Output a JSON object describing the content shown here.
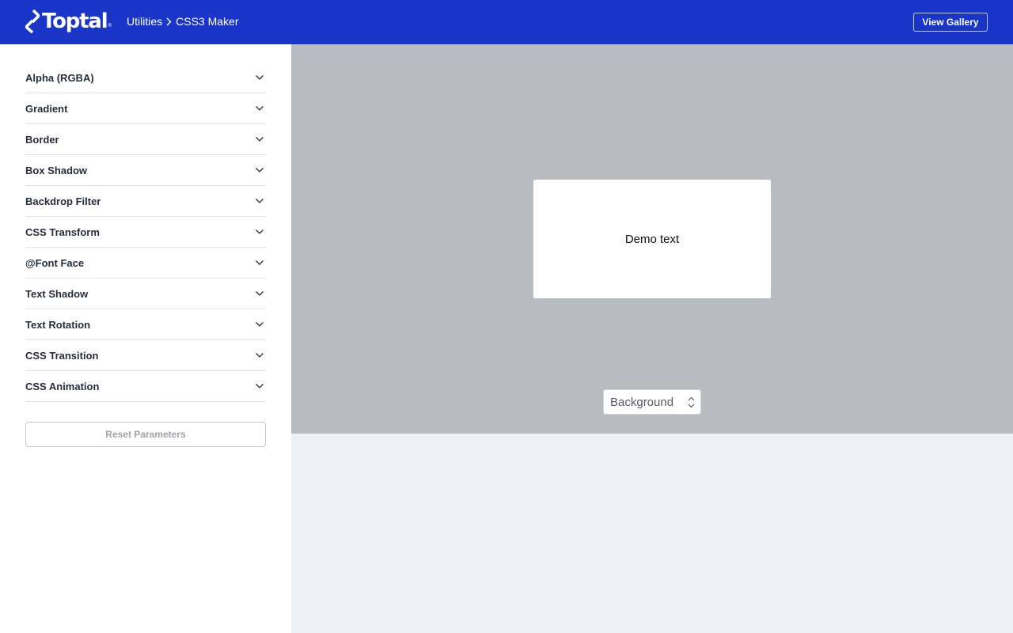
{
  "header": {
    "logo_text": "Toptal",
    "logo_reg": "®",
    "breadcrumb": [
      "Utilities",
      "CSS3 Maker"
    ],
    "gallery_button": "View Gallery"
  },
  "sidebar": {
    "items": [
      {
        "label": "Alpha (RGBA)"
      },
      {
        "label": "Gradient"
      },
      {
        "label": "Border"
      },
      {
        "label": "Box Shadow"
      },
      {
        "label": "Backdrop Filter"
      },
      {
        "label": "CSS Transform"
      },
      {
        "label": "@Font Face"
      },
      {
        "label": "Text Shadow"
      },
      {
        "label": "Text Rotation"
      },
      {
        "label": "CSS Transition"
      },
      {
        "label": "CSS Animation"
      }
    ],
    "reset_button": "Reset Parameters"
  },
  "preview": {
    "demo_text": "Demo text",
    "background_select": "Background"
  },
  "colors": {
    "header_bg": "#1a36c8",
    "preview_bg": "#b8bbc0",
    "page_bg": "#eff0f5"
  },
  "icons": [
    "toptal-logo-icon",
    "chevron-right-icon",
    "chevron-down-icon",
    "up-down-arrows-icon"
  ]
}
